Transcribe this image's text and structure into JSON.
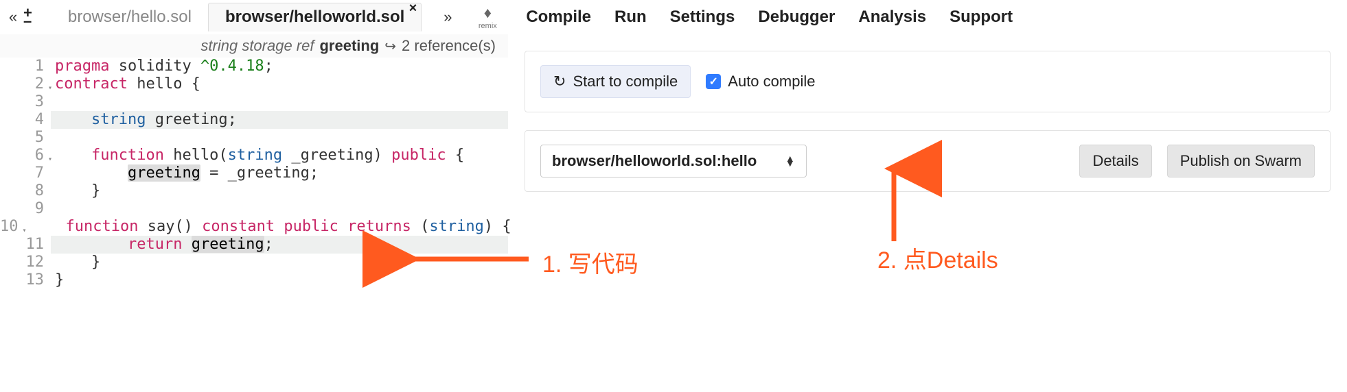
{
  "toolbar": {
    "back_glyph": "«",
    "plus_glyph": "+",
    "minus_glyph": "–",
    "more_glyph": "»"
  },
  "tabs": {
    "inactive": "browser/hello.sol",
    "active": "browser/helloworld.sol",
    "close_glyph": "×"
  },
  "logo": {
    "glyph": "♦",
    "label": "remix"
  },
  "menu": {
    "compile": "Compile",
    "run": "Run",
    "settings": "Settings",
    "debugger": "Debugger",
    "analysis": "Analysis",
    "support": "Support"
  },
  "refbar": {
    "type_hint": "string storage ref",
    "symbol": "greeting",
    "share_glyph": "↪",
    "refs": "2 reference(s)"
  },
  "code": {
    "l1": {
      "n": "1",
      "a": "pragma",
      "b": " solidity ",
      "c": "^0.4.18",
      "d": ";"
    },
    "l2": {
      "n": "2",
      "a": "contract",
      "b": " hello {"
    },
    "l3": {
      "n": "3",
      "a": ""
    },
    "l4": {
      "n": "4",
      "a": "    ",
      "b": "string",
      "c": " greeting;"
    },
    "l5": {
      "n": "5",
      "a": ""
    },
    "l6": {
      "n": "6",
      "a": "    ",
      "b": "function",
      "c": " hello(",
      "d": "string",
      "e": " _greeting) ",
      "f": "public",
      "g": " {"
    },
    "l7": {
      "n": "7",
      "a": "        ",
      "b": "greeting",
      "c": " = _greeting;"
    },
    "l8": {
      "n": "8",
      "a": "    }"
    },
    "l9": {
      "n": "9",
      "a": ""
    },
    "l10": {
      "n": "10",
      "a": "    ",
      "b": "function",
      "c": " say() ",
      "d": "constant",
      "e": " ",
      "f": "public",
      "g": " ",
      "h": "returns",
      "i": " (",
      "j": "string",
      "k": ") {"
    },
    "l11": {
      "n": "11",
      "a": "        ",
      "b": "return",
      "c": " ",
      "d": "greeting",
      "e": ";"
    },
    "l12": {
      "n": "12",
      "a": "    }"
    },
    "l13": {
      "n": "13",
      "a": "}"
    }
  },
  "compile_panel": {
    "start_label": "Start to compile",
    "refresh_glyph": "↻",
    "auto_label": "Auto compile",
    "check_glyph": "✓"
  },
  "contract_panel": {
    "selected": "browser/helloworld.sol:hello",
    "caret_up": "▲",
    "caret_down": "▼",
    "details_label": "Details",
    "publish_label": "Publish on Swarm"
  },
  "annotations": {
    "step1": "1. 写代码",
    "step2": "2. 点Details"
  }
}
